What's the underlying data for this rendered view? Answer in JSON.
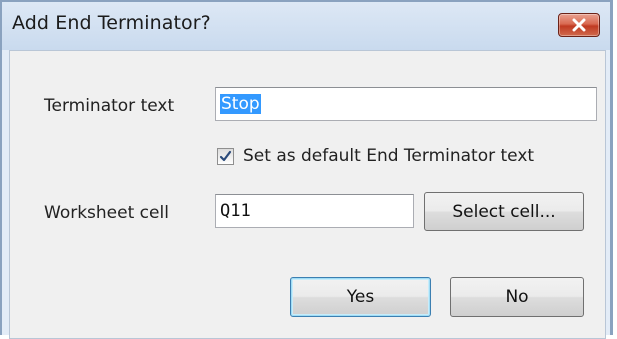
{
  "dialog": {
    "title": "Add End Terminator?"
  },
  "form": {
    "terminator_label": "Terminator text",
    "terminator_value": "Stop",
    "default_checkbox": {
      "label": "Set as default End Terminator text",
      "checked": true
    },
    "cell_label": "Worksheet cell",
    "cell_value": "Q11",
    "select_cell_label": "Select cell..."
  },
  "buttons": {
    "yes_label": "Yes",
    "no_label": "No"
  },
  "icons": {
    "close": "close-icon",
    "check": "check-icon"
  },
  "colors": {
    "close_button": "#c9432b",
    "selection": "#3399ff",
    "default_button_border": "#3c7fb1"
  }
}
